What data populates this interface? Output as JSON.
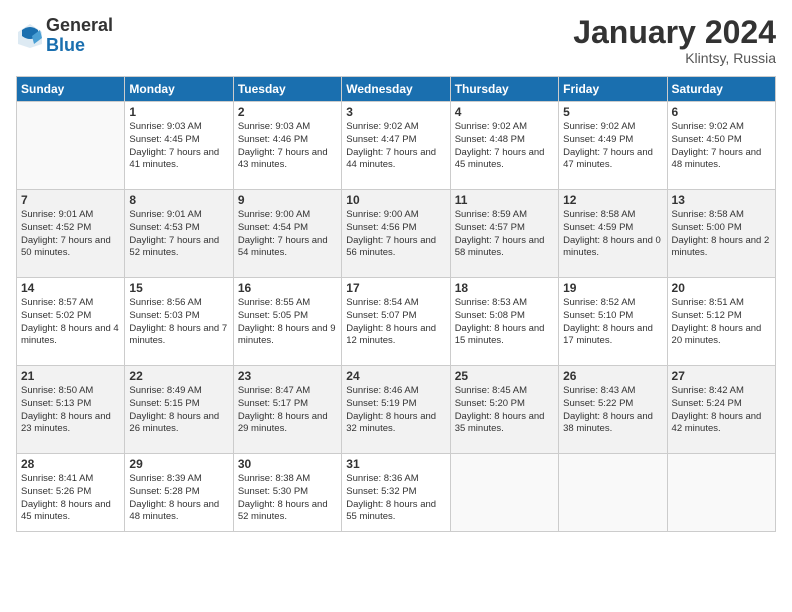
{
  "header": {
    "logo_general": "General",
    "logo_blue": "Blue",
    "month_title": "January 2024",
    "location": "Klintsy, Russia"
  },
  "weekdays": [
    "Sunday",
    "Monday",
    "Tuesday",
    "Wednesday",
    "Thursday",
    "Friday",
    "Saturday"
  ],
  "weeks": [
    [
      {
        "day": "",
        "sunrise": "",
        "sunset": "",
        "daylight": ""
      },
      {
        "day": "1",
        "sunrise": "Sunrise: 9:03 AM",
        "sunset": "Sunset: 4:45 PM",
        "daylight": "Daylight: 7 hours and 41 minutes."
      },
      {
        "day": "2",
        "sunrise": "Sunrise: 9:03 AM",
        "sunset": "Sunset: 4:46 PM",
        "daylight": "Daylight: 7 hours and 43 minutes."
      },
      {
        "day": "3",
        "sunrise": "Sunrise: 9:02 AM",
        "sunset": "Sunset: 4:47 PM",
        "daylight": "Daylight: 7 hours and 44 minutes."
      },
      {
        "day": "4",
        "sunrise": "Sunrise: 9:02 AM",
        "sunset": "Sunset: 4:48 PM",
        "daylight": "Daylight: 7 hours and 45 minutes."
      },
      {
        "day": "5",
        "sunrise": "Sunrise: 9:02 AM",
        "sunset": "Sunset: 4:49 PM",
        "daylight": "Daylight: 7 hours and 47 minutes."
      },
      {
        "day": "6",
        "sunrise": "Sunrise: 9:02 AM",
        "sunset": "Sunset: 4:50 PM",
        "daylight": "Daylight: 7 hours and 48 minutes."
      }
    ],
    [
      {
        "day": "7",
        "sunrise": "Sunrise: 9:01 AM",
        "sunset": "Sunset: 4:52 PM",
        "daylight": "Daylight: 7 hours and 50 minutes."
      },
      {
        "day": "8",
        "sunrise": "Sunrise: 9:01 AM",
        "sunset": "Sunset: 4:53 PM",
        "daylight": "Daylight: 7 hours and 52 minutes."
      },
      {
        "day": "9",
        "sunrise": "Sunrise: 9:00 AM",
        "sunset": "Sunset: 4:54 PM",
        "daylight": "Daylight: 7 hours and 54 minutes."
      },
      {
        "day": "10",
        "sunrise": "Sunrise: 9:00 AM",
        "sunset": "Sunset: 4:56 PM",
        "daylight": "Daylight: 7 hours and 56 minutes."
      },
      {
        "day": "11",
        "sunrise": "Sunrise: 8:59 AM",
        "sunset": "Sunset: 4:57 PM",
        "daylight": "Daylight: 7 hours and 58 minutes."
      },
      {
        "day": "12",
        "sunrise": "Sunrise: 8:58 AM",
        "sunset": "Sunset: 4:59 PM",
        "daylight": "Daylight: 8 hours and 0 minutes."
      },
      {
        "day": "13",
        "sunrise": "Sunrise: 8:58 AM",
        "sunset": "Sunset: 5:00 PM",
        "daylight": "Daylight: 8 hours and 2 minutes."
      }
    ],
    [
      {
        "day": "14",
        "sunrise": "Sunrise: 8:57 AM",
        "sunset": "Sunset: 5:02 PM",
        "daylight": "Daylight: 8 hours and 4 minutes."
      },
      {
        "day": "15",
        "sunrise": "Sunrise: 8:56 AM",
        "sunset": "Sunset: 5:03 PM",
        "daylight": "Daylight: 8 hours and 7 minutes."
      },
      {
        "day": "16",
        "sunrise": "Sunrise: 8:55 AM",
        "sunset": "Sunset: 5:05 PM",
        "daylight": "Daylight: 8 hours and 9 minutes."
      },
      {
        "day": "17",
        "sunrise": "Sunrise: 8:54 AM",
        "sunset": "Sunset: 5:07 PM",
        "daylight": "Daylight: 8 hours and 12 minutes."
      },
      {
        "day": "18",
        "sunrise": "Sunrise: 8:53 AM",
        "sunset": "Sunset: 5:08 PM",
        "daylight": "Daylight: 8 hours and 15 minutes."
      },
      {
        "day": "19",
        "sunrise": "Sunrise: 8:52 AM",
        "sunset": "Sunset: 5:10 PM",
        "daylight": "Daylight: 8 hours and 17 minutes."
      },
      {
        "day": "20",
        "sunrise": "Sunrise: 8:51 AM",
        "sunset": "Sunset: 5:12 PM",
        "daylight": "Daylight: 8 hours and 20 minutes."
      }
    ],
    [
      {
        "day": "21",
        "sunrise": "Sunrise: 8:50 AM",
        "sunset": "Sunset: 5:13 PM",
        "daylight": "Daylight: 8 hours and 23 minutes."
      },
      {
        "day": "22",
        "sunrise": "Sunrise: 8:49 AM",
        "sunset": "Sunset: 5:15 PM",
        "daylight": "Daylight: 8 hours and 26 minutes."
      },
      {
        "day": "23",
        "sunrise": "Sunrise: 8:47 AM",
        "sunset": "Sunset: 5:17 PM",
        "daylight": "Daylight: 8 hours and 29 minutes."
      },
      {
        "day": "24",
        "sunrise": "Sunrise: 8:46 AM",
        "sunset": "Sunset: 5:19 PM",
        "daylight": "Daylight: 8 hours and 32 minutes."
      },
      {
        "day": "25",
        "sunrise": "Sunrise: 8:45 AM",
        "sunset": "Sunset: 5:20 PM",
        "daylight": "Daylight: 8 hours and 35 minutes."
      },
      {
        "day": "26",
        "sunrise": "Sunrise: 8:43 AM",
        "sunset": "Sunset: 5:22 PM",
        "daylight": "Daylight: 8 hours and 38 minutes."
      },
      {
        "day": "27",
        "sunrise": "Sunrise: 8:42 AM",
        "sunset": "Sunset: 5:24 PM",
        "daylight": "Daylight: 8 hours and 42 minutes."
      }
    ],
    [
      {
        "day": "28",
        "sunrise": "Sunrise: 8:41 AM",
        "sunset": "Sunset: 5:26 PM",
        "daylight": "Daylight: 8 hours and 45 minutes."
      },
      {
        "day": "29",
        "sunrise": "Sunrise: 8:39 AM",
        "sunset": "Sunset: 5:28 PM",
        "daylight": "Daylight: 8 hours and 48 minutes."
      },
      {
        "day": "30",
        "sunrise": "Sunrise: 8:38 AM",
        "sunset": "Sunset: 5:30 PM",
        "daylight": "Daylight: 8 hours and 52 minutes."
      },
      {
        "day": "31",
        "sunrise": "Sunrise: 8:36 AM",
        "sunset": "Sunset: 5:32 PM",
        "daylight": "Daylight: 8 hours and 55 minutes."
      },
      {
        "day": "",
        "sunrise": "",
        "sunset": "",
        "daylight": ""
      },
      {
        "day": "",
        "sunrise": "",
        "sunset": "",
        "daylight": ""
      },
      {
        "day": "",
        "sunrise": "",
        "sunset": "",
        "daylight": ""
      }
    ]
  ]
}
